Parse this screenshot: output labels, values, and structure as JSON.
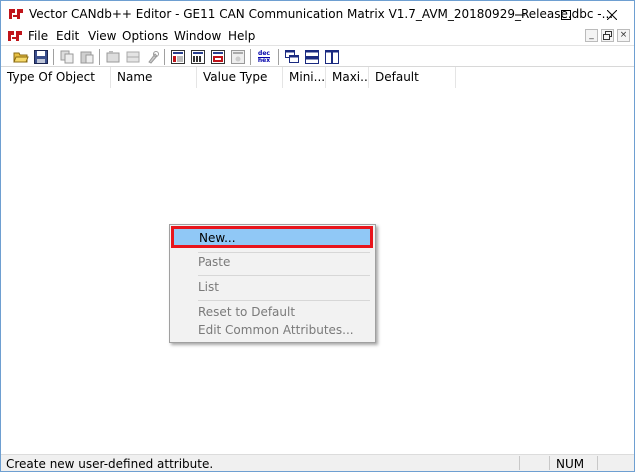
{
  "window": {
    "title": "Vector CANdb++ Editor - GE11 CAN Communication Matrix V1.7_AVM_20180929_Release.dbc -...",
    "controls": {
      "minimize": "—",
      "maximize": "☐",
      "close": "✕"
    }
  },
  "menubar": {
    "items": [
      "File",
      "Edit",
      "View",
      "Options",
      "Window",
      "Help"
    ],
    "mdi_controls": [
      "_",
      "🗗",
      "×"
    ]
  },
  "toolbar": {
    "dec_hex": "dec\nhex",
    "buttons": [
      "open-icon",
      "save-icon",
      "copy-icon",
      "paste-icon",
      "properties-icon",
      "grid-icon",
      "tool-icon",
      "view-1-icon",
      "view-2-icon",
      "view-3-icon",
      "view-4-icon",
      "dec-hex-icon",
      "cascade-icon",
      "tile-horizontal-icon",
      "tile-vertical-icon"
    ]
  },
  "columns": [
    "Type Of Object",
    "Name",
    "Value Type",
    "Mini...",
    "Maxi...",
    "Default"
  ],
  "context_menu": {
    "items": [
      {
        "label": "New...",
        "enabled": true,
        "highlighted": true
      },
      {
        "label": "Paste",
        "enabled": false
      },
      {
        "label": "List",
        "enabled": false
      },
      {
        "label": "Reset to Default",
        "enabled": false
      },
      {
        "label": "Edit Common Attributes...",
        "enabled": false
      }
    ]
  },
  "statusbar": {
    "message": "Create new user-defined attribute.",
    "num": "NUM"
  },
  "colors": {
    "highlight": "#90c8f6",
    "highlight_border": "#e8151c",
    "disabled_text": "#7a7a7a",
    "window_border": "#6e9fd1"
  }
}
